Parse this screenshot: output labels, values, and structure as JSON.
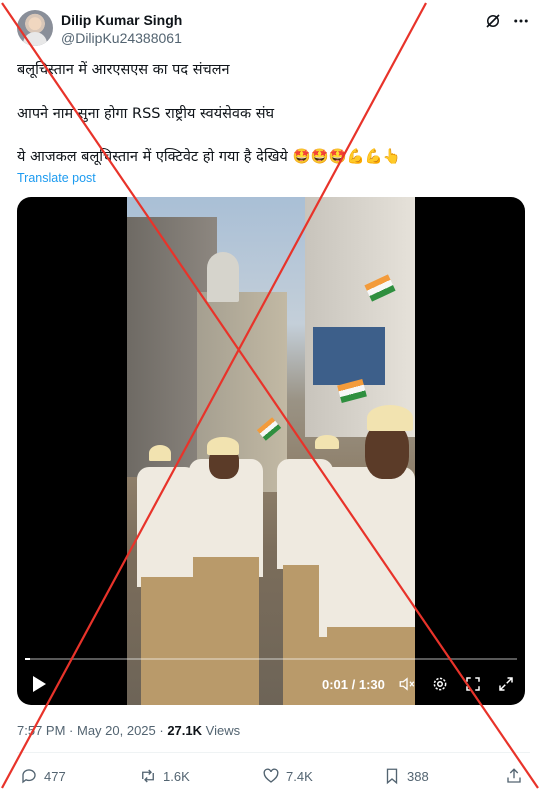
{
  "author": {
    "display_name": "Dilip Kumar Singh",
    "handle": "@DilipKu24388061"
  },
  "tweet": {
    "lines": [
      "बलूचिस्तान में आरएसएस का पद संचलन",
      "आपने नाम सुना होगा RSS राष्ट्रीय स्वयंसेवक संघ",
      "ये आजकल बलूचिस्तान में एक्टिवेट हो गया है देखिये 🤩🤩🤩💪💪👆"
    ],
    "translate_label": "Translate post"
  },
  "video": {
    "time_display": "0:01 / 1:30",
    "progress": 0.01
  },
  "meta": {
    "time": "7:57 PM",
    "separator": " · ",
    "date": "May 20, 2025",
    "views_count": "27.1K",
    "views_label": " Views"
  },
  "actions": {
    "replies": "477",
    "reposts": "1.6K",
    "likes": "7.4K",
    "bookmarks": "388"
  },
  "colors": {
    "accent": "#1d9bf0",
    "text": "#0f1419",
    "secondary": "#536471",
    "overlay_cross": "#e8332a"
  },
  "icons": [
    "grok-icon",
    "more-icon",
    "play-icon",
    "volume-icon",
    "settings-icon",
    "fullscreen-icon",
    "expand-icon",
    "reply-icon",
    "repost-icon",
    "like-icon",
    "bookmark-icon",
    "share-icon"
  ]
}
